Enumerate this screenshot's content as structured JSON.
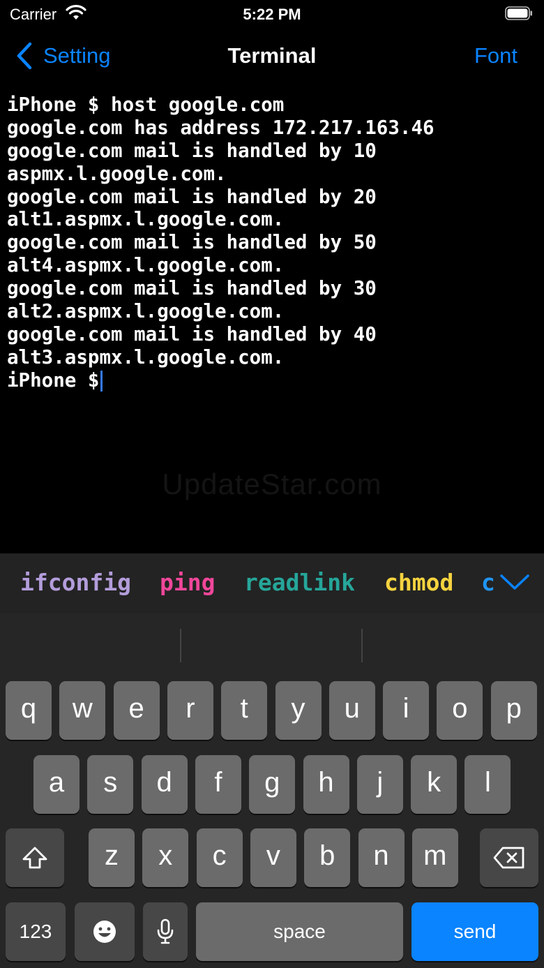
{
  "status_bar": {
    "carrier": "Carrier",
    "time": "5:22 PM"
  },
  "nav": {
    "back_label": "Setting",
    "title": "Terminal",
    "right_label": "Font"
  },
  "terminal": {
    "lines": [
      "iPhone $ host google.com",
      "google.com has address 172.217.163.46",
      "google.com mail is handled by 10",
      "aspmx.l.google.com.",
      "google.com mail is handled by 20",
      "alt1.aspmx.l.google.com.",
      "google.com mail is handled by 50",
      "alt4.aspmx.l.google.com.",
      "google.com mail is handled by 30",
      "alt2.aspmx.l.google.com.",
      "google.com mail is handled by 40",
      "alt3.aspmx.l.google.com."
    ],
    "prompt": "iPhone $ "
  },
  "watermark": "UpdateStar.com",
  "command_suggestions": [
    {
      "label": "ifconfig",
      "color": "#b39ddb"
    },
    {
      "label": "ping",
      "color": "#f0479a"
    },
    {
      "label": "readlink",
      "color": "#26a69a"
    },
    {
      "label": "chmod",
      "color": "#f5d33f"
    },
    {
      "label": "c",
      "color": "#2196f3"
    }
  ],
  "keyboard": {
    "row1": [
      "q",
      "w",
      "e",
      "r",
      "t",
      "y",
      "u",
      "i",
      "o",
      "p"
    ],
    "row2": [
      "a",
      "s",
      "d",
      "f",
      "g",
      "h",
      "j",
      "k",
      "l"
    ],
    "row3": [
      "z",
      "x",
      "c",
      "v",
      "b",
      "n",
      "m"
    ],
    "numbers_label": "123",
    "space_label": "space",
    "send_label": "send"
  },
  "colors": {
    "accent": "#0a84ff",
    "send_key": "#0a84ff",
    "cursor": "#3478f6"
  }
}
